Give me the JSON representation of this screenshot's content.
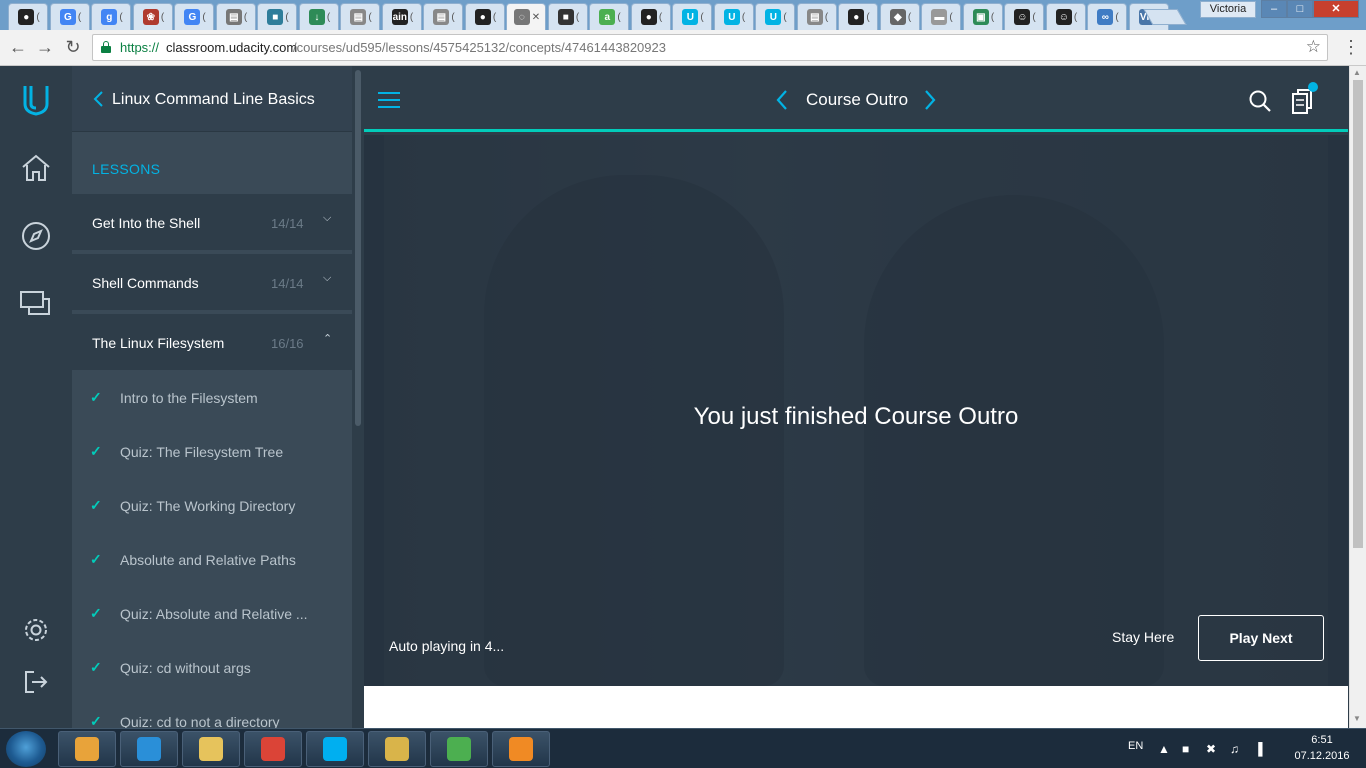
{
  "browser": {
    "tabs": [
      {
        "icon": "github-icon",
        "glyph": "●",
        "color": "#222222"
      },
      {
        "icon": "google-icon",
        "glyph": "G",
        "color": "#4285f4"
      },
      {
        "icon": "google-icon",
        "glyph": "g",
        "color": "#4285f4"
      },
      {
        "icon": "paw-icon",
        "glyph": "❀",
        "color": "#b03a2e"
      },
      {
        "icon": "google-icon",
        "glyph": "G",
        "color": "#4285f4"
      },
      {
        "icon": "page-icon",
        "glyph": "▤",
        "color": "#777777"
      },
      {
        "icon": "chat-icon",
        "glyph": "■",
        "color": "#2e7d9a"
      },
      {
        "icon": "download-icon",
        "glyph": "↓",
        "color": "#2e8b57"
      },
      {
        "icon": "page-icon",
        "glyph": "▤",
        "color": "#888888"
      },
      {
        "icon": "ain-icon",
        "glyph": "ain",
        "color": "#222222"
      },
      {
        "icon": "page-icon",
        "glyph": "▤",
        "color": "#888888"
      },
      {
        "icon": "github-icon",
        "glyph": "●",
        "color": "#222222"
      },
      {
        "icon": "loading-icon",
        "glyph": "◌",
        "color": "#777777",
        "active": true,
        "close": "✕"
      },
      {
        "icon": "terminal-icon",
        "glyph": "■",
        "color": "#333333"
      },
      {
        "icon": "a-icon",
        "glyph": "a",
        "color": "#4caf50"
      },
      {
        "icon": "github-icon",
        "glyph": "●",
        "color": "#222222"
      },
      {
        "icon": "udacity-icon",
        "glyph": "U",
        "color": "#02b3e4"
      },
      {
        "icon": "udacity-icon",
        "glyph": "U",
        "color": "#02b3e4"
      },
      {
        "icon": "udacity-icon",
        "glyph": "U",
        "color": "#02b3e4"
      },
      {
        "icon": "page-icon",
        "glyph": "▤",
        "color": "#888888"
      },
      {
        "icon": "github-icon",
        "glyph": "●",
        "color": "#222222"
      },
      {
        "icon": "stack-icon",
        "glyph": "◆",
        "color": "#666666"
      },
      {
        "icon": "toggle-icon",
        "glyph": "▬",
        "color": "#999999"
      },
      {
        "icon": "netping-icon",
        "glyph": "▣",
        "color": "#2e8b57"
      },
      {
        "icon": "avatar-icon",
        "glyph": "☺",
        "color": "#222222"
      },
      {
        "icon": "avatar-icon",
        "glyph": "☺",
        "color": "#222222"
      },
      {
        "icon": "infinity-icon",
        "glyph": "∞",
        "color": "#3f7cc4"
      },
      {
        "icon": "vk-icon",
        "glyph": "VK",
        "color": "#4a76a8"
      }
    ],
    "tab_tick": "(",
    "window_user": "Victoria",
    "window_controls": {
      "minimize": "–",
      "maximize": "□",
      "close": "✕"
    },
    "url": {
      "scheme": "https://",
      "host": "classroom.udacity.com",
      "path": "/courses/ud595/lessons/4575425132/concepts/47461443820923"
    },
    "nav": {
      "back": "←",
      "forward": "→",
      "reload": "↻",
      "star": "☆",
      "menu": "⋮"
    }
  },
  "sidebar": {
    "course_title": "Linux Command Line Basics",
    "lessons_label": "LESSONS",
    "lessons": [
      {
        "title": "Get Into the Shell",
        "count": "14/14",
        "expanded": false
      },
      {
        "title": "Shell Commands",
        "count": "14/14",
        "expanded": false
      },
      {
        "title": "The Linux Filesystem",
        "count": "16/16",
        "expanded": true
      }
    ],
    "chevron_down": "⌵",
    "chevron_up": "⌃",
    "check": "✓",
    "concepts": [
      "Intro to the Filesystem",
      "Quiz: The Filesystem Tree",
      "Quiz: The Working Directory",
      "Absolute and Relative Paths",
      "Quiz: Absolute and Relative ...",
      "Quiz: cd without args",
      "Quiz: cd to not a directory"
    ]
  },
  "header": {
    "concept_title": "Course Outro"
  },
  "video": {
    "finished_text": "You just finished Course Outro",
    "autoplay_text": "Auto playing in 4...",
    "stay_here": "Stay Here",
    "play_next": "Play Next"
  },
  "taskbar": {
    "apps": [
      {
        "name": "media-player-icon",
        "color": "#e8a33a"
      },
      {
        "name": "internet-explorer-icon",
        "color": "#2a8fd8"
      },
      {
        "name": "file-explorer-icon",
        "color": "#e6c35c"
      },
      {
        "name": "chrome-icon",
        "color": "#db4437"
      },
      {
        "name": "skype-icon",
        "color": "#00aff0"
      },
      {
        "name": "paint-icon",
        "color": "#d9b44a"
      },
      {
        "name": "git-icon",
        "color": "#4caf50"
      },
      {
        "name": "vlc-icon",
        "color": "#f08a24"
      }
    ],
    "lang": "EN",
    "tray_icons": [
      "▲",
      "■",
      "✖",
      "♫",
      "▐"
    ],
    "time": "6:51",
    "date": "07.12.2016"
  },
  "colors": {
    "accent_blue": "#02b3e4",
    "accent_teal": "#02ccba",
    "dark_bg": "#2e3d49"
  }
}
